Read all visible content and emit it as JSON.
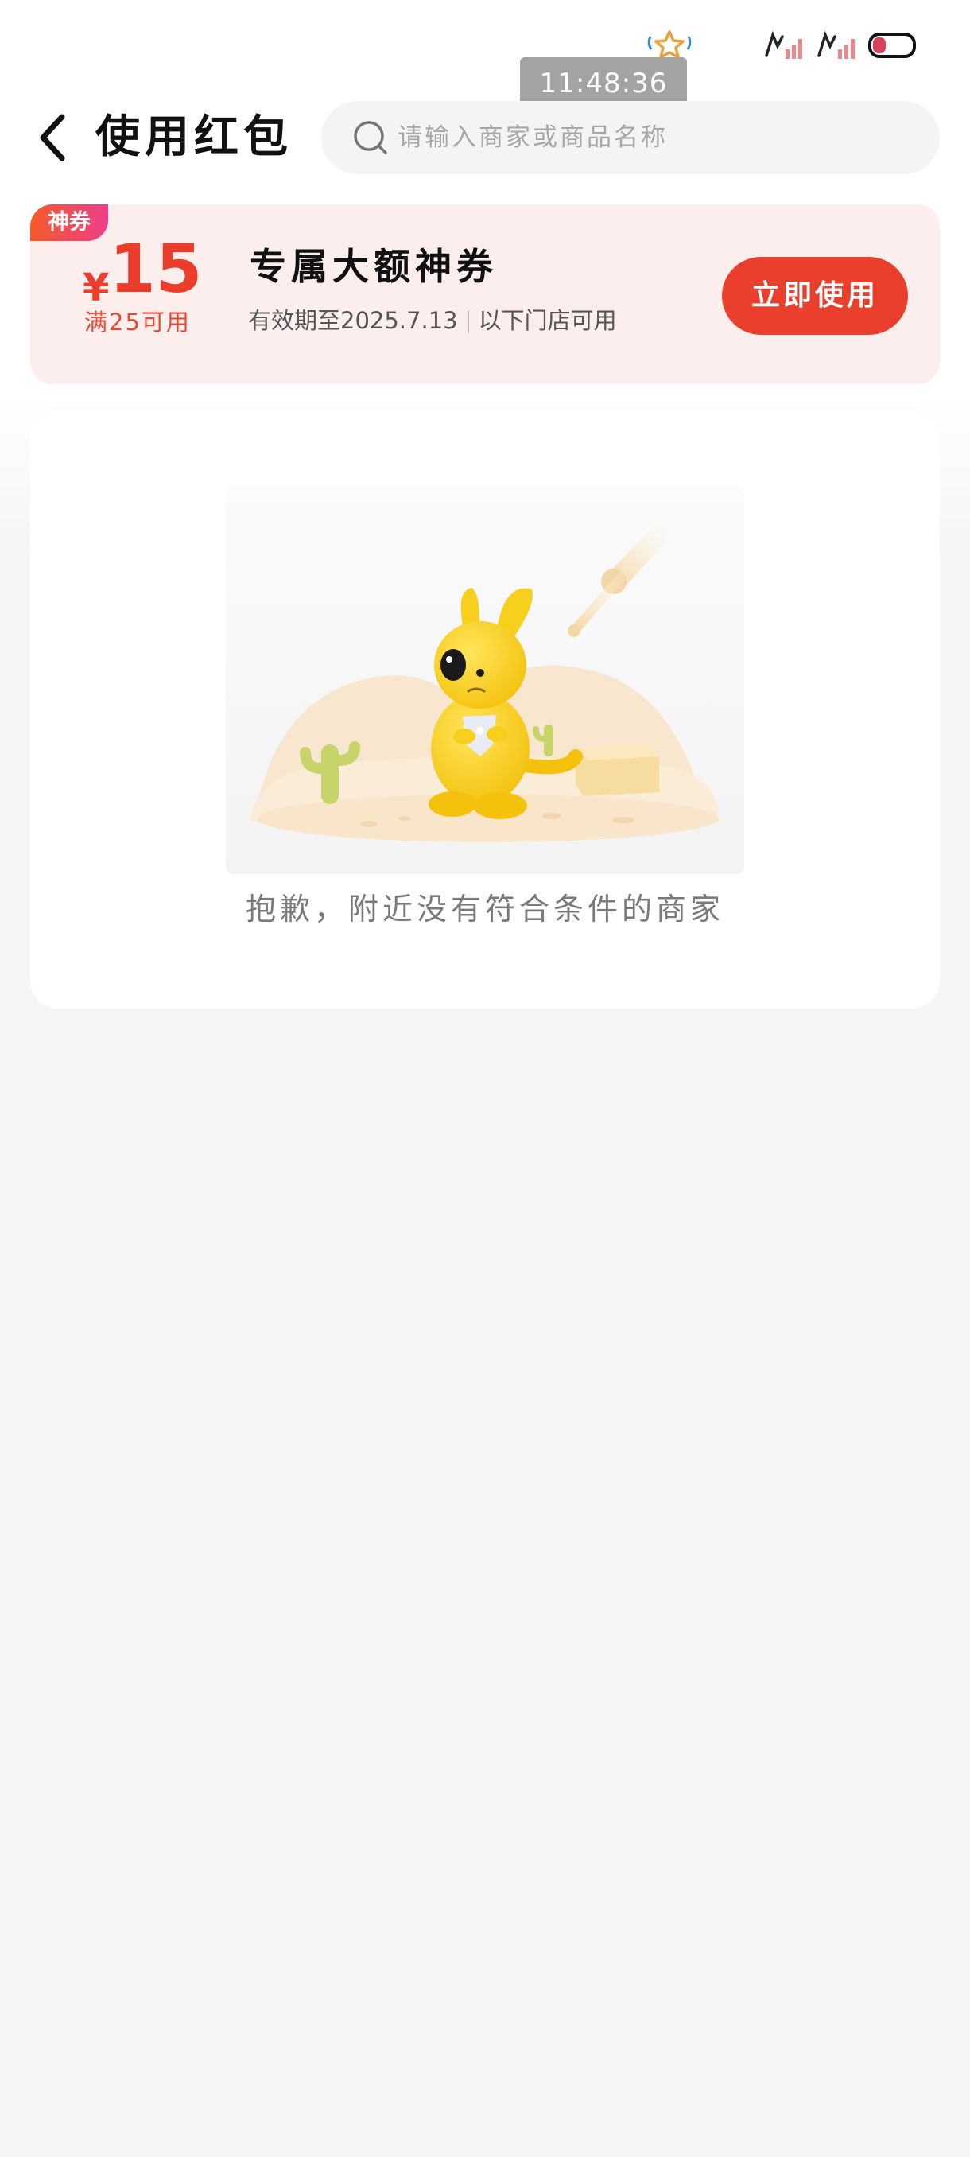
{
  "status_bar": {
    "time": "11:48:36"
  },
  "header": {
    "title": "使用红包",
    "back_icon": "chevron-left-icon",
    "search": {
      "placeholder": "请输入商家或商品名称",
      "icon": "search-icon"
    }
  },
  "coupon": {
    "tag": "神券",
    "currency": "¥",
    "amount": "15",
    "threshold": "满25可用",
    "name": "专属大额神券",
    "validity": "有效期至2025.7.13",
    "scope": "以下门店可用",
    "button_label": "立即使用",
    "accent_color": "#ea3f2c",
    "background_color": "#fdeeee"
  },
  "empty_state": {
    "illustration": "kangaroo-desert-illustration",
    "message": "抱歉，附近没有符合条件的商家"
  }
}
